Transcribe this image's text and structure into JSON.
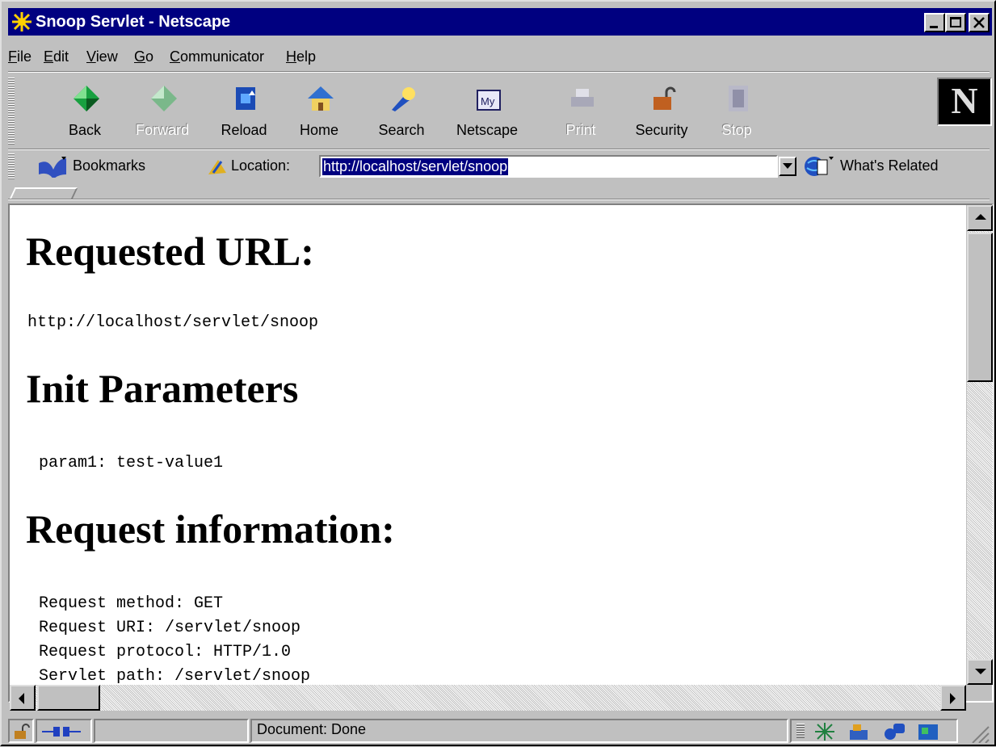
{
  "window": {
    "title": "Snoop Servlet - Netscape",
    "minimize_label": "_",
    "maximize_label": "□",
    "close_label": "✕"
  },
  "menu": [
    {
      "label": "File",
      "accel": "F",
      "rest": "ile"
    },
    {
      "label": "Edit",
      "accel": "E",
      "rest": "dit"
    },
    {
      "label": "View",
      "accel": "V",
      "rest": "iew"
    },
    {
      "label": "Go",
      "accel": "G",
      "rest": "o"
    },
    {
      "label": "Communicator",
      "accel": "C",
      "rest": "ommunicator"
    },
    {
      "label": "Help",
      "accel": "H",
      "rest": "elp"
    }
  ],
  "toolbar": {
    "back": "Back",
    "forward": "Forward",
    "reload": "Reload",
    "home": "Home",
    "search": "Search",
    "netscape": "Netscape",
    "print": "Print",
    "security": "Security",
    "stop": "Stop",
    "logo": "N"
  },
  "location_bar": {
    "bookmarks": "Bookmarks",
    "location_label": "Location:",
    "url": "http://localhost/servlet/snoop",
    "whats_related": "What's Related"
  },
  "content": {
    "heading_requested_url": "Requested URL:",
    "requested_url": "http://localhost/servlet/snoop",
    "heading_init_params": "Init Parameters",
    "init_param": "param1: test-value1",
    "heading_request_info": "Request information:",
    "request_lines": [
      "Request method: GET",
      "Request URI: /servlet/snoop",
      "Request protocol: HTTP/1.0",
      "Servlet path: /servlet/snoop"
    ]
  },
  "status": {
    "text": "Document: Done"
  },
  "colors": {
    "titlebar": "#000080",
    "face": "#c0c0c0",
    "content_bg": "#ffffff"
  }
}
